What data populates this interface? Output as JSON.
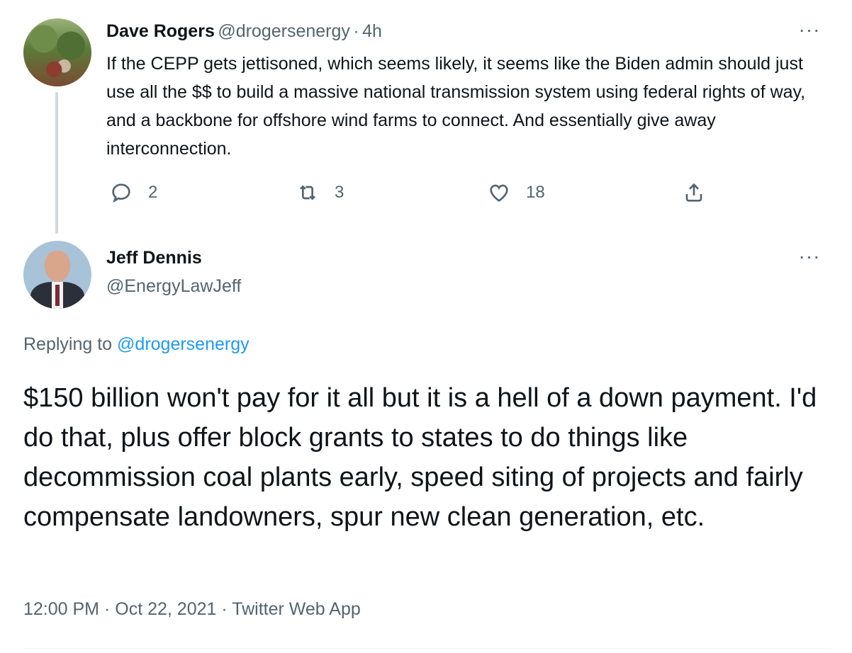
{
  "parent_tweet": {
    "author_name": "Dave Rogers",
    "author_handle": "@drogersenergy",
    "separator": "·",
    "time": "4h",
    "more": "···",
    "text": "If the CEPP gets jettisoned, which seems likely, it seems like the Biden admin should just use all the $$ to build a massive national transmission system using federal rights of way, and a backbone for offshore wind farms to connect. And essentially give away interconnection.",
    "actions": {
      "reply_count": "2",
      "retweet_count": "3",
      "like_count": "18"
    }
  },
  "main_tweet": {
    "author_name": "Jeff Dennis",
    "author_handle": "@EnergyLawJeff",
    "more": "···",
    "replying_prefix": "Replying to",
    "replying_to": "@drogersenergy",
    "text": "$150 billion won't pay for it all but it is a hell of a down payment. I'd do that, plus offer block grants to states to do things like decommission coal plants early, speed siting of projects and fairly compensate landowners, spur new clean generation, etc.",
    "time": "12:00 PM",
    "dot1": "·",
    "date": "Oct 22, 2021",
    "dot2": "·",
    "app": "Twitter Web App"
  },
  "icons": {
    "reply": "reply-icon",
    "retweet": "retweet-icon",
    "like": "heart-icon",
    "share": "share-icon"
  },
  "colors": {
    "text": "#0f1419",
    "secondary": "#536471",
    "link": "#1d9bf0",
    "thread_line": "#cfd9de"
  }
}
